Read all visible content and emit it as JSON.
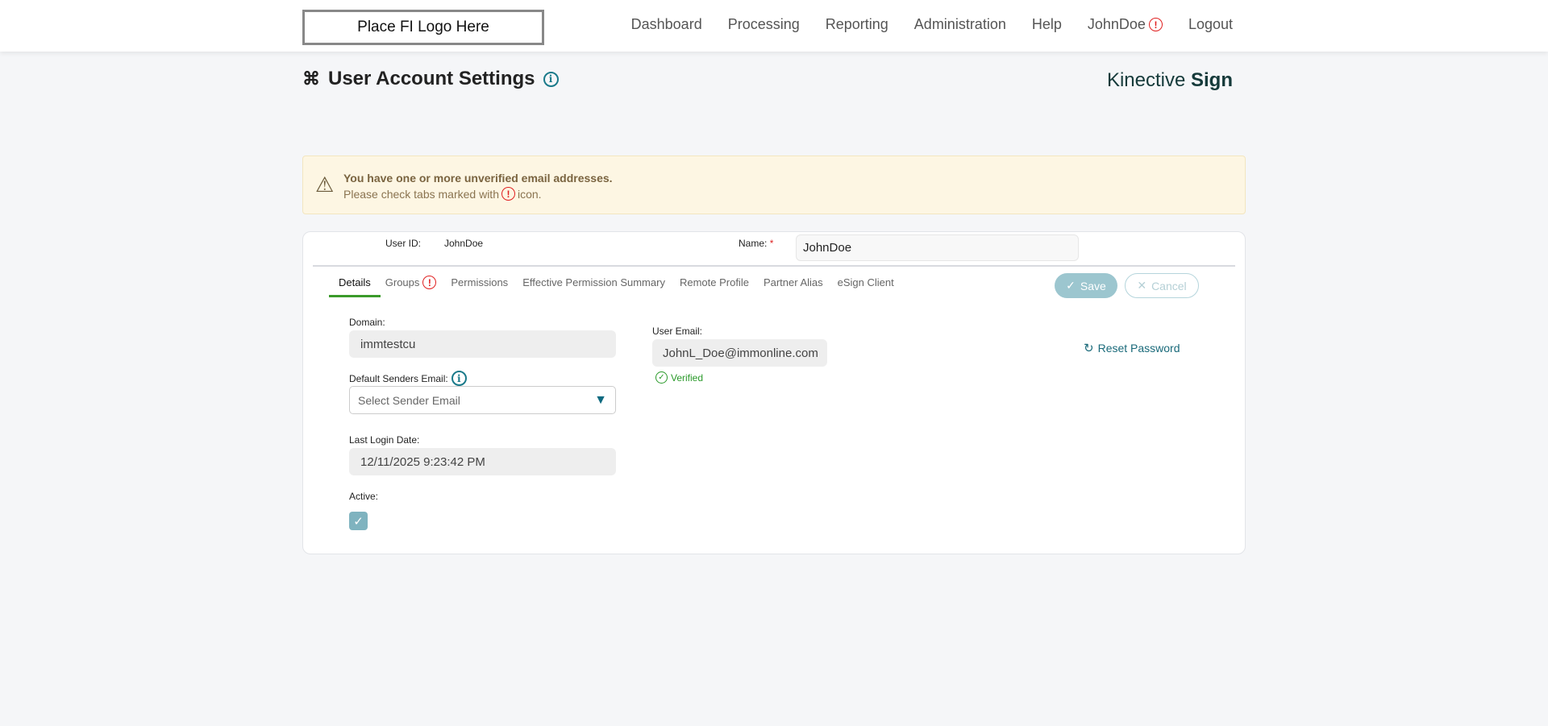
{
  "header": {
    "logo": "Place FI Logo Here",
    "nav": [
      "Dashboard",
      "Processing",
      "Reporting",
      "Administration",
      "Help",
      "JohnDoe",
      "Logout"
    ]
  },
  "page": {
    "title": "User Account Settings",
    "brand_light": "Kinective",
    "brand_bold": "Sign"
  },
  "alert": {
    "title": "You have one or more unverified email addresses.",
    "msg_pre": "Please check tabs marked with",
    "msg_post": "icon."
  },
  "user": {
    "id_label": "User ID:",
    "id_value": "JohnDoe",
    "name_label": "Name:",
    "required": "*",
    "name_value": "JohnDoe"
  },
  "tabs": [
    "Details",
    "Groups",
    "Permissions",
    "Effective Permission Summary",
    "Remote Profile",
    "Partner Alias",
    "eSign Client"
  ],
  "actions": {
    "save": "Save",
    "cancel": "Cancel",
    "reset": "Reset Password"
  },
  "details": {
    "domain_label": "Domain:",
    "domain_value": "immtestcu",
    "sender_label": "Default Senders Email:",
    "sender_placeholder": "Select Sender Email",
    "login_label": "Last Login Date:",
    "login_value": "12/11/2025 9:23:42 PM",
    "active_label": "Active:",
    "active": true,
    "email_label": "User Email:",
    "email_value": "JohnL_Doe@immonline.com",
    "verified": "Verified"
  }
}
